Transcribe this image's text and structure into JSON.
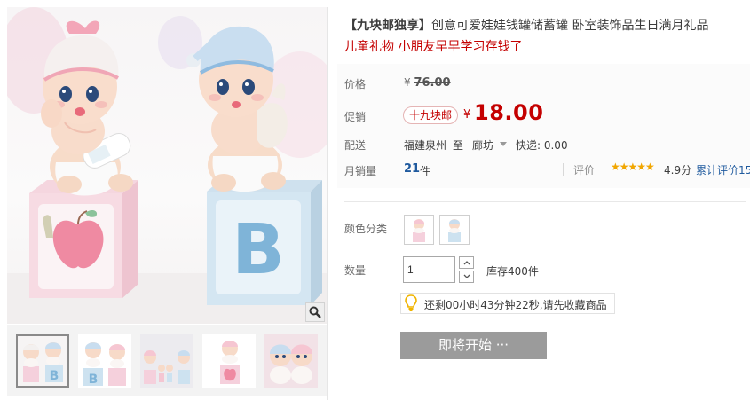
{
  "product": {
    "title_tag": "【九块邮独享】",
    "title_main": "创意可爱娃娃钱罐储蓄罐 卧室装饰品生日满月礼品",
    "subtitle": "儿童礼物 小朋友早早学习存钱了"
  },
  "price": {
    "label": "价格",
    "currency": "¥",
    "original": "76.00"
  },
  "promo": {
    "label": "促销",
    "tag": "十九块邮",
    "currency": "¥",
    "price": "18.00"
  },
  "shipping": {
    "label": "配送",
    "from": "福建泉州",
    "to_word": "至",
    "to": "廊坊",
    "fee": "快递: 0.00"
  },
  "sales": {
    "label": "月销量",
    "count": "21",
    "unit": "件",
    "review_label": "评价",
    "stars": "★★★★★",
    "score": "4.9分",
    "cumulative": "累计评价15"
  },
  "options": {
    "color_label": "颜色分类"
  },
  "quantity": {
    "label": "数量",
    "value": "1",
    "stock": "库存400件"
  },
  "notice": {
    "text": "还剩00小时43分钟22秒,请先收藏商品"
  },
  "buttons": {
    "coming_soon": "即将开始 ···"
  },
  "colors": {
    "price_red": "#c40000",
    "link_blue": "#1f5a9e",
    "star_orange": "#f1a600",
    "button_gray": "#9b9b9b"
  }
}
